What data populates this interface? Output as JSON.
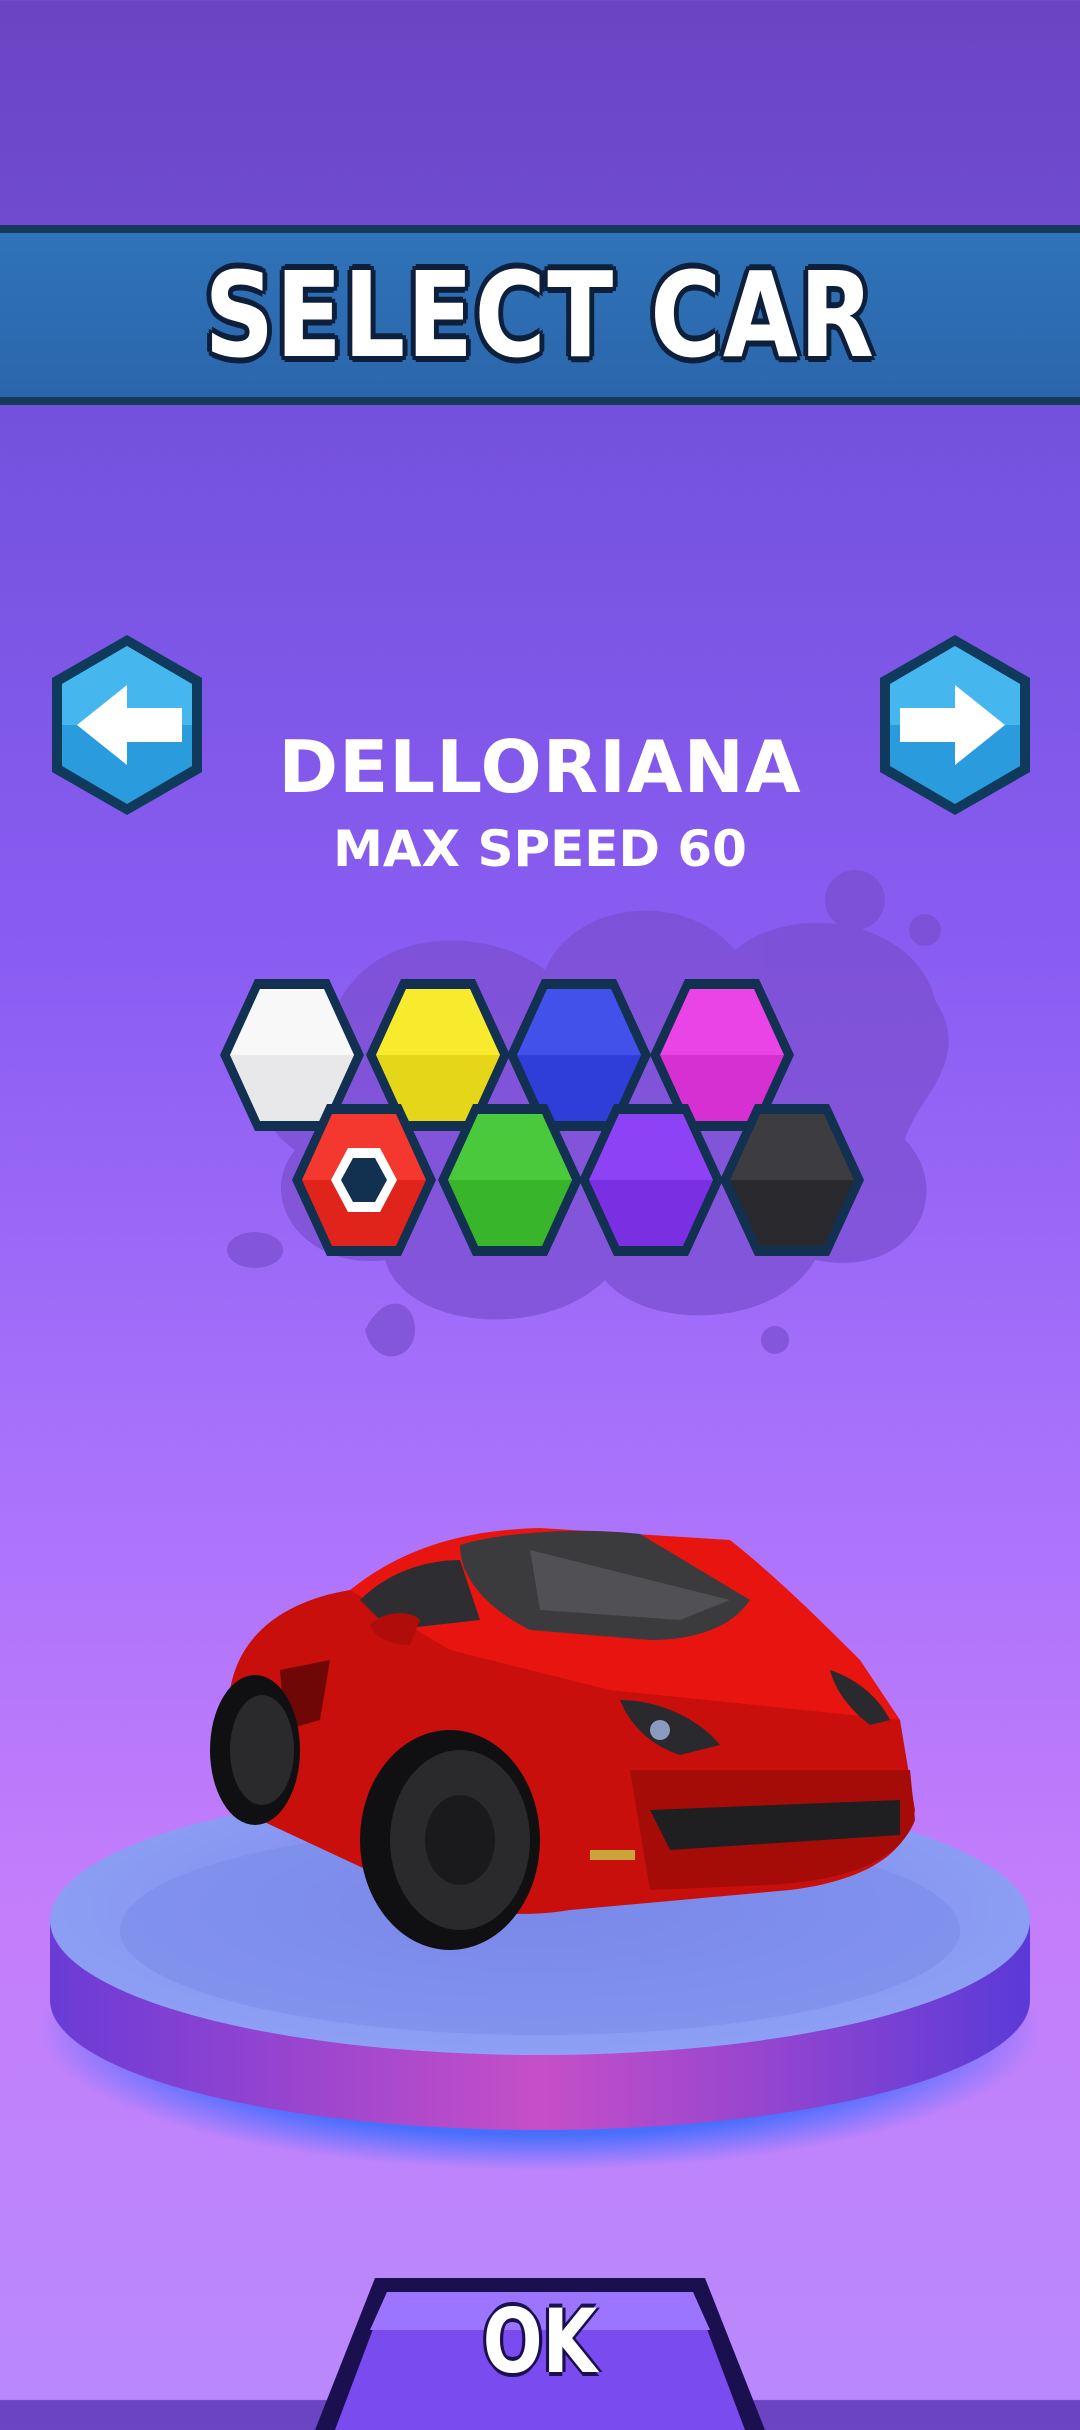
{
  "header": {
    "title": "SELECT CAR"
  },
  "navigation": {
    "prev_icon": "arrow-left-icon",
    "next_icon": "arrow-right-icon"
  },
  "car": {
    "name": "DELLORIANA",
    "speed_text": "MAX SPEED 60",
    "color": "#e8140f"
  },
  "colors": {
    "selected": "red",
    "options": [
      {
        "name": "white",
        "hex": "#e8e8ea"
      },
      {
        "name": "yellow",
        "hex": "#e6d619"
      },
      {
        "name": "blue",
        "hex": "#2f3ed8"
      },
      {
        "name": "magenta",
        "hex": "#d62fd2"
      },
      {
        "name": "red",
        "hex": "#e0241c"
      },
      {
        "name": "green",
        "hex": "#38b52a"
      },
      {
        "name": "purple",
        "hex": "#7a2fe2"
      },
      {
        "name": "black",
        "hex": "#2a2a2e"
      }
    ]
  },
  "footer": {
    "ok_label": "OK"
  }
}
